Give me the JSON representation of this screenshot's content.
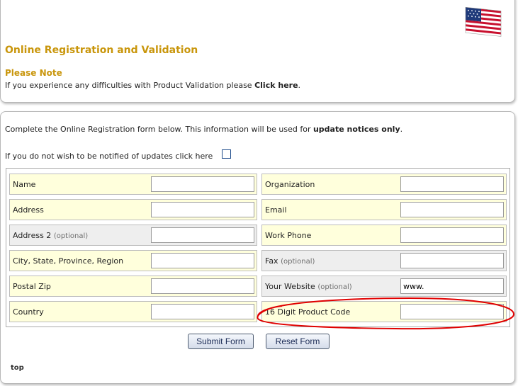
{
  "header": {
    "title": "Online Registration and Validation",
    "note_heading": "Please Note",
    "note_text": "If you experience any difficulties with Product Validation please ",
    "note_link": "Click here",
    "note_end": "."
  },
  "form": {
    "intro_text": "Complete the Online Registration form below. This information will be used for ",
    "intro_bold": "update notices only",
    "intro_end": ".",
    "optout_label": "If you do not wish to be notified of updates click here",
    "optout_checked": false,
    "left_fields": [
      {
        "label": "Name",
        "optional": "",
        "value": ""
      },
      {
        "label": "Address",
        "optional": "",
        "value": ""
      },
      {
        "label": "Address 2",
        "optional": "(optional)",
        "value": ""
      },
      {
        "label": "City, State, Province, Region",
        "optional": "",
        "value": ""
      },
      {
        "label": "Postal Zip",
        "optional": "",
        "value": ""
      },
      {
        "label": "Country",
        "optional": "",
        "value": ""
      }
    ],
    "right_fields": [
      {
        "label": "Organization",
        "optional": "",
        "value": ""
      },
      {
        "label": "Email",
        "optional": "",
        "value": ""
      },
      {
        "label": "Work Phone",
        "optional": "",
        "value": ""
      },
      {
        "label": "Fax",
        "optional": "(optional)",
        "value": ""
      },
      {
        "label": "Your Website",
        "optional": "(optional)",
        "value": "www."
      },
      {
        "label": "16 Digit Product Code",
        "optional": "",
        "value": ""
      }
    ],
    "submit_label": "Submit Form",
    "reset_label": "Reset Form"
  },
  "footer": {
    "top_link": "top"
  },
  "colors": {
    "accent": "#c9960c",
    "required_row": "#ffffdc",
    "optional_row": "#eeeeee",
    "annotation": "#e00000"
  },
  "icons": {
    "flag": "us-flag-icon"
  }
}
